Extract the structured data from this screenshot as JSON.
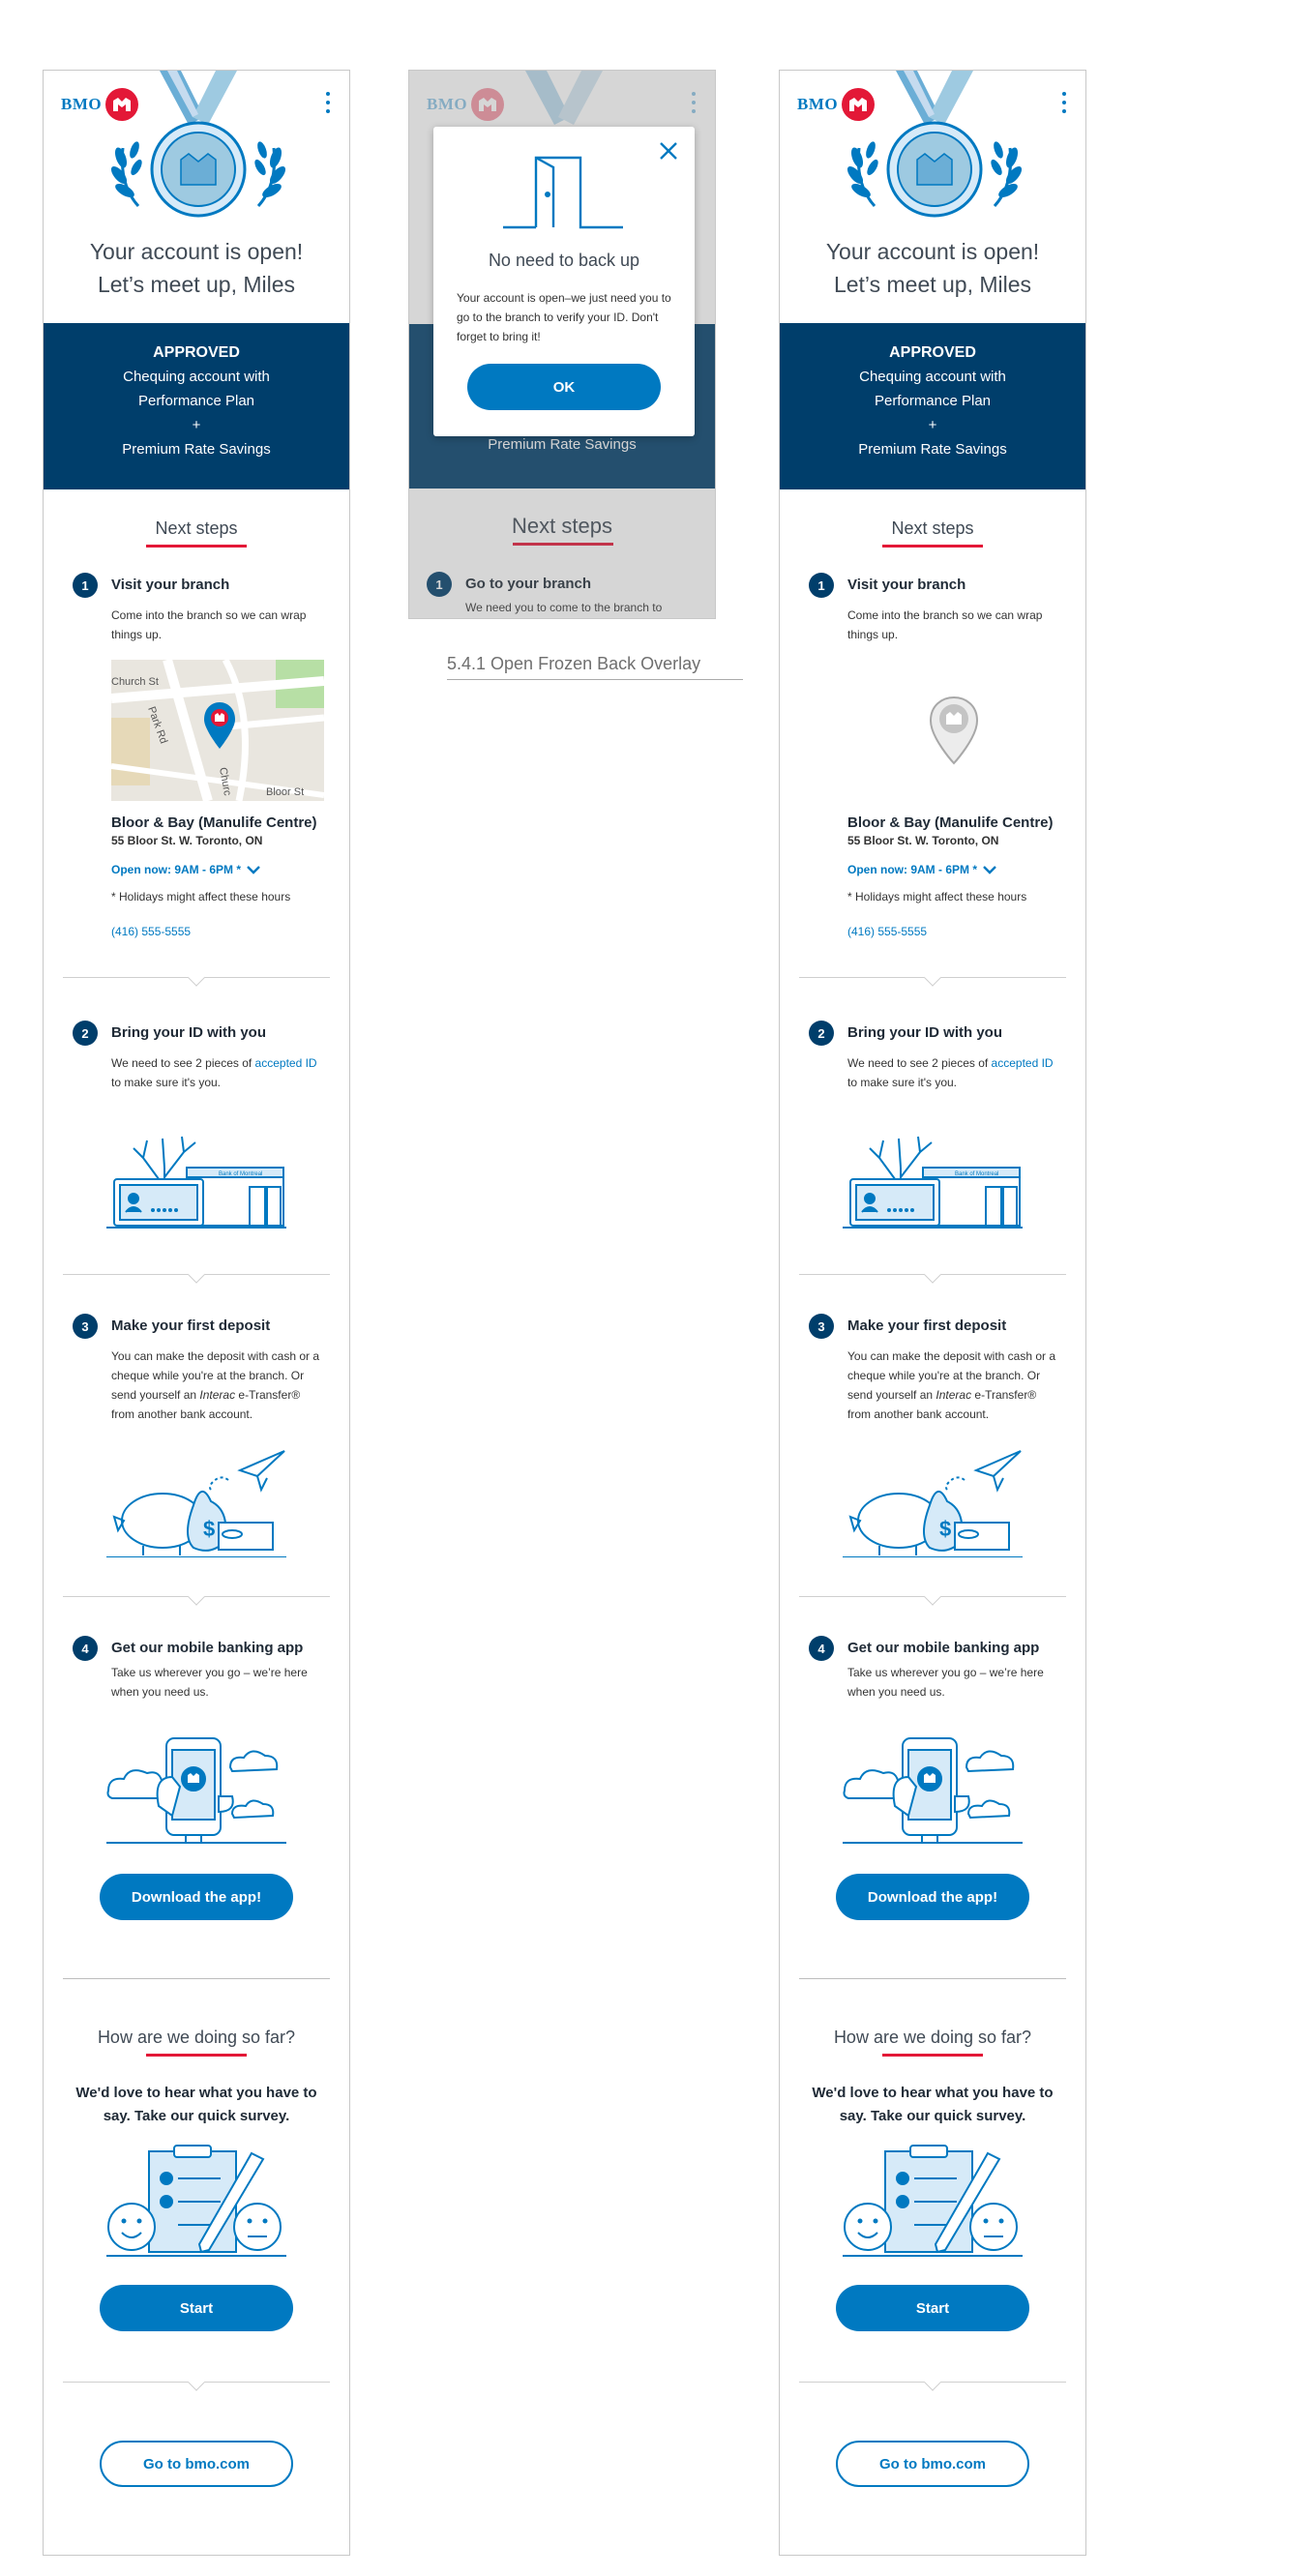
{
  "app": {
    "brand": "BMO",
    "menu_icon": "kebab-menu-icon"
  },
  "hero": {
    "title_line1": "Your account is open!",
    "title_line2": "Let’s meet up, Miles"
  },
  "approved": {
    "title": "APPROVED",
    "line1": "Chequing account with",
    "line2": "Performance Plan",
    "plus": "+",
    "line3": "Premium Rate Savings"
  },
  "next_steps": {
    "heading": "Next steps"
  },
  "step1": {
    "num": "1",
    "title": "Visit your branch",
    "body": "Come into the branch so we can wrap things up.",
    "map_labels": {
      "church": "Church St",
      "park": "Park Rd",
      "church2": "Churc",
      "bloor": "Bloor St"
    },
    "branch_name": "Bloor & Bay (Manulife Centre)",
    "branch_address": "55 Bloor St. W. Toronto, ON",
    "hours": "Open now: 9AM - 6PM *",
    "note": "* Holidays might affect these hours",
    "phone": "(416) 555-5555"
  },
  "step2": {
    "num": "2",
    "title": "Bring your ID with you",
    "body_pre": "We need to see 2 pieces of ",
    "body_link": "accepted ID",
    "body_post": " to make sure it's you.",
    "sign": "Bank of Montreal"
  },
  "step3": {
    "num": "3",
    "title": "Make your first deposit",
    "body_pre": "You can make the deposit with cash or a cheque while you're at the branch. Or send yourself an ",
    "body_em": "Interac",
    "body_post": " e-Transfer® from another bank account."
  },
  "step4": {
    "num": "4",
    "title": "Get our mobile banking app",
    "body": "Take us wherever you go – we’re here when you need us.",
    "button": "Download the app!"
  },
  "survey": {
    "heading": "How are we doing so far?",
    "text": "We'd love to hear what you have to say. Take our quick survey.",
    "button": "Start"
  },
  "footer": {
    "button": "Go to bmo.com"
  },
  "overlay": {
    "title": "No need to back up",
    "body": "Your account is open–we just need you to go to the branch to verify your ID. Don't forget to bring it!",
    "ok": "OK",
    "bg_savings": "Premium Rate Savings",
    "bg_next_steps": "Next steps",
    "bg_step_title": "Go to your branch",
    "bg_step_body": "We need you to come to the branch to"
  },
  "caption": "5.4.1 Open Frozen Back Overlay",
  "colors": {
    "brand_blue": "#0079c1",
    "navy": "#003e6b",
    "red": "#e31837"
  }
}
